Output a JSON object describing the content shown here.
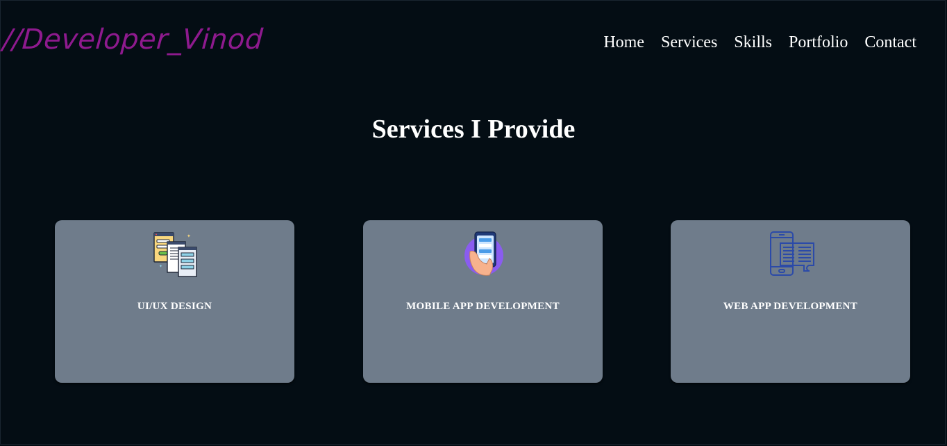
{
  "logo": "//Developer_Vinod",
  "nav": [
    "Home",
    "Services",
    "Skills",
    "Portfolio",
    "Contact"
  ],
  "heading": "Services I Provide",
  "services": [
    {
      "title": "UI/UX DESIGN",
      "icon": "ui-ux-screens-icon"
    },
    {
      "title": "MOBILE APP DEVELOPMENT",
      "icon": "hand-holding-phone-icon"
    },
    {
      "title": "WEB APP DEVELOPMENT",
      "icon": "web-app-devices-icon"
    }
  ],
  "colors": {
    "background": "#040d14",
    "logo": "#8e1a8e",
    "card": "#6f7c8b",
    "text": "#ffffff"
  }
}
